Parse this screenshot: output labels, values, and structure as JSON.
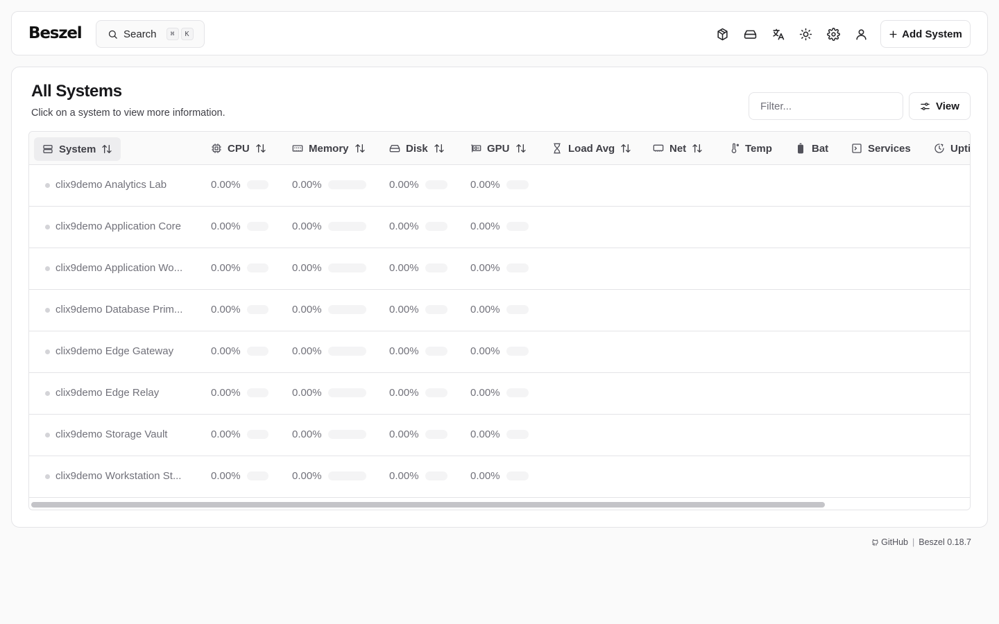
{
  "app": {
    "logo": "Beszel"
  },
  "search": {
    "label": "Search",
    "shortcut": [
      "⌘",
      "K"
    ]
  },
  "nav_icons": [
    "containers-icon",
    "disk-icon",
    "language-icon",
    "theme-icon",
    "settings-icon",
    "user-icon"
  ],
  "add_system_label": "Add System",
  "page": {
    "title": "All Systems",
    "subtitle": "Click on a system to view more information."
  },
  "filter": {
    "placeholder": "Filter...",
    "value": ""
  },
  "view_label": "View",
  "columns": [
    {
      "label": "System",
      "icon": "server-icon",
      "sortable": true
    },
    {
      "label": "CPU",
      "icon": "cpu-icon",
      "sortable": true
    },
    {
      "label": "Memory",
      "icon": "memory-icon",
      "sortable": true
    },
    {
      "label": "Disk",
      "icon": "disk-icon",
      "sortable": true
    },
    {
      "label": "GPU",
      "icon": "gpu-icon",
      "sortable": true
    },
    {
      "label": "Load Avg",
      "icon": "hourglass-icon",
      "sortable": true
    },
    {
      "label": "Net",
      "icon": "network-icon",
      "sortable": true
    },
    {
      "label": "Temp",
      "icon": "thermometer-icon",
      "sortable": false
    },
    {
      "label": "Bat",
      "icon": "battery-icon",
      "sortable": false
    },
    {
      "label": "Services",
      "icon": "terminal-icon",
      "sortable": false
    },
    {
      "label": "Upti",
      "icon": "clock-icon",
      "sortable": false
    }
  ],
  "systems": [
    {
      "name": "clix9demo Analytics Lab",
      "cpu": "0.00%",
      "memory": "0.00%",
      "disk": "0.00%",
      "gpu": "0.00%"
    },
    {
      "name": "clix9demo Application Core",
      "cpu": "0.00%",
      "memory": "0.00%",
      "disk": "0.00%",
      "gpu": "0.00%"
    },
    {
      "name": "clix9demo Application Wo...",
      "cpu": "0.00%",
      "memory": "0.00%",
      "disk": "0.00%",
      "gpu": "0.00%"
    },
    {
      "name": "clix9demo Database Prim...",
      "cpu": "0.00%",
      "memory": "0.00%",
      "disk": "0.00%",
      "gpu": "0.00%"
    },
    {
      "name": "clix9demo Edge Gateway",
      "cpu": "0.00%",
      "memory": "0.00%",
      "disk": "0.00%",
      "gpu": "0.00%"
    },
    {
      "name": "clix9demo Edge Relay",
      "cpu": "0.00%",
      "memory": "0.00%",
      "disk": "0.00%",
      "gpu": "0.00%"
    },
    {
      "name": "clix9demo Storage Vault",
      "cpu": "0.00%",
      "memory": "0.00%",
      "disk": "0.00%",
      "gpu": "0.00%"
    },
    {
      "name": "clix9demo Workstation St...",
      "cpu": "0.00%",
      "memory": "0.00%",
      "disk": "0.00%",
      "gpu": "0.00%"
    }
  ],
  "footer": {
    "github": "GitHub",
    "version": "Beszel 0.18.7"
  }
}
